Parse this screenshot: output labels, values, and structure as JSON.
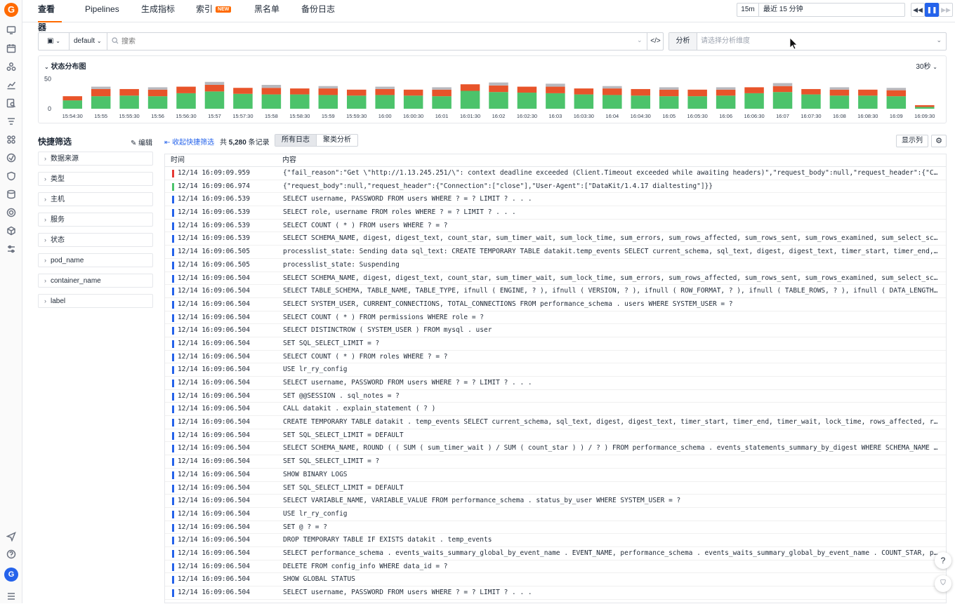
{
  "app": {
    "logo_letter": "G",
    "avatar_letter": "G"
  },
  "nav": {
    "tabs": [
      {
        "label": "查看器",
        "active": true
      },
      {
        "label": "Pipelines"
      },
      {
        "label": "生成指标"
      },
      {
        "label": "索引",
        "badge": "NEW"
      },
      {
        "label": "黑名单"
      },
      {
        "label": "备份日志"
      }
    ]
  },
  "time": {
    "short": "15m",
    "range": "最近 15 分钟",
    "rewind": "◀◀",
    "pause": "❚❚",
    "forward": "▶▶"
  },
  "query": {
    "index": "default",
    "search_placeholder": "搜索",
    "code_label": "</>"
  },
  "analysis": {
    "label": "分析",
    "placeholder": "请选择分析维度"
  },
  "chart": {
    "title": "状态分布图",
    "interval": "30秒",
    "colors": {
      "ok": "#4cc36b",
      "error": "#e8542a",
      "other": "#b8b8bd"
    }
  },
  "chart_data": {
    "type": "bar",
    "title": "状态分布图",
    "stacked": true,
    "ylim": [
      0,
      60
    ],
    "yticks": [
      0,
      50
    ],
    "grid": false,
    "categories": [
      "15:54:30",
      "15:55",
      "15:55:30",
      "15:56",
      "15:56:30",
      "15:57",
      "15:57:30",
      "15:58",
      "15:58:30",
      "15:59",
      "15:59:30",
      "16:00",
      "16:00:30",
      "16:01",
      "16:01:30",
      "16:02",
      "16:02:30",
      "16:03",
      "16:03:30",
      "16:04",
      "16:04:30",
      "16:05",
      "16:05:30",
      "16:06",
      "16:06:30",
      "16:07",
      "16:07:30",
      "16:08",
      "16:08:30",
      "16:09",
      "16:09:30"
    ],
    "series": [
      {
        "key": "ok",
        "values": [
          14,
          21,
          22,
          21,
          26,
          29,
          25,
          24,
          24,
          23,
          22,
          23,
          22,
          21,
          30,
          28,
          27,
          26,
          24,
          23,
          22,
          21,
          21,
          22,
          26,
          28,
          24,
          22,
          22,
          21,
          3
        ]
      },
      {
        "key": "error",
        "values": [
          7,
          12,
          11,
          11,
          11,
          11,
          10,
          11,
          10,
          11,
          10,
          10,
          10,
          11,
          11,
          11,
          10,
          11,
          10,
          11,
          11,
          11,
          11,
          10,
          10,
          10,
          9,
          10,
          10,
          10,
          3
        ]
      },
      {
        "key": "other",
        "values": [
          0,
          4,
          0,
          4,
          0,
          5,
          0,
          5,
          0,
          4,
          0,
          4,
          0,
          4,
          0,
          5,
          0,
          5,
          0,
          4,
          0,
          4,
          0,
          4,
          0,
          5,
          0,
          4,
          0,
          4,
          0
        ]
      }
    ]
  },
  "quick_filter": {
    "title": "快捷筛选",
    "edit": "编辑",
    "items": [
      "数据来源",
      "类型",
      "主机",
      "服务",
      "状态",
      "pod_name",
      "container_name",
      "label"
    ]
  },
  "list": {
    "collapse": "收起快捷筛选",
    "total_prefix": "共",
    "total": "5,280",
    "total_suffix": "条记录",
    "view_tabs": [
      "所有日志",
      "聚类分析"
    ],
    "show_columns": "显示列",
    "col_time": "时间",
    "col_content": "内容"
  },
  "logs": [
    {
      "time": "12/14 16:09:09.959",
      "level": "#e53935",
      "content": "{\"fail_reason\":\"Get \\\"http://1.13.245.251/\\\": context deadline exceeded (Client.Timeout exceeded while awaiting headers)\",\"request_body\":null,\"request_header\":{\"Connection\":[\"close\"],\"User-Agent\":[\"DataKit/1.4.17 dialtesting\"]}}"
    },
    {
      "time": "12/14 16:09:06.974",
      "level": "#4cc36b",
      "content": "{\"request_body\":null,\"request_header\":{\"Connection\":[\"close\"],\"User-Agent\":[\"DataKit/1.4.17 dialtesting\"]}}"
    },
    {
      "time": "12/14 16:09:06.539",
      "level": "#2563eb",
      "content": "SELECT username, PASSWORD FROM users WHERE ? = ? LIMIT ? . . ."
    },
    {
      "time": "12/14 16:09:06.539",
      "level": "#2563eb",
      "content": "SELECT role, username FROM roles WHERE ? = ? LIMIT ? . . ."
    },
    {
      "time": "12/14 16:09:06.539",
      "level": "#2563eb",
      "content": "SELECT COUNT ( * ) FROM users WHERE ? = ?"
    },
    {
      "time": "12/14 16:09:06.539",
      "level": "#2563eb",
      "content": "SELECT SCHEMA_NAME, digest, digest_text, count_star, sum_timer_wait, sum_lock_time, sum_errors, sum_rows_affected, sum_rows_sent, sum_rows_examined, sum_select_scan, sum_select_full_join"
    },
    {
      "time": "12/14 16:09:06.505",
      "level": "#2563eb",
      "content": "processlist_state: Sending data sql_text: CREATE TEMPORARY TABLE datakit.temp_events SELECT current_schema, sql_text, digest, digest_text, timer_start, timer_end, timer_wait, lock_time"
    },
    {
      "time": "12/14 16:09:06.505",
      "level": "#2563eb",
      "content": "processlist_state: Suspending"
    },
    {
      "time": "12/14 16:09:06.504",
      "level": "#2563eb",
      "content": "SELECT SCHEMA_NAME, digest, digest_text, count_star, sum_timer_wait, sum_lock_time, sum_errors, sum_rows_affected, sum_rows_sent, sum_rows_examined, sum_select_scan, sum_select_full_join"
    },
    {
      "time": "12/14 16:09:06.504",
      "level": "#2563eb",
      "content": "SELECT TABLE_SCHEMA, TABLE_NAME, TABLE_TYPE, ifnull ( ENGINE, ? ), ifnull ( VERSION, ? ), ifnull ( ROW_FORMAT, ? ), ifnull ( TABLE_ROWS, ? ), ifnull ( DATA_LENGTH, ? ), ifnull ( INDEX_LENGTH, ? )"
    },
    {
      "time": "12/14 16:09:06.504",
      "level": "#2563eb",
      "content": "SELECT SYSTEM_USER, CURRENT_CONNECTIONS, TOTAL_CONNECTIONS FROM performance_schema . users WHERE SYSTEM_USER = ?"
    },
    {
      "time": "12/14 16:09:06.504",
      "level": "#2563eb",
      "content": "SELECT COUNT ( * ) FROM permissions WHERE role = ?"
    },
    {
      "time": "12/14 16:09:06.504",
      "level": "#2563eb",
      "content": "SELECT DISTINCTROW ( SYSTEM_USER ) FROM mysql . user"
    },
    {
      "time": "12/14 16:09:06.504",
      "level": "#2563eb",
      "content": "SET SQL_SELECT_LIMIT = ?"
    },
    {
      "time": "12/14 16:09:06.504",
      "level": "#2563eb",
      "content": "SELECT COUNT ( * ) FROM roles WHERE ? = ?"
    },
    {
      "time": "12/14 16:09:06.504",
      "level": "#2563eb",
      "content": "USE lr_ry_config"
    },
    {
      "time": "12/14 16:09:06.504",
      "level": "#2563eb",
      "content": "SELECT username, PASSWORD FROM users WHERE ? = ? LIMIT ? . . ."
    },
    {
      "time": "12/14 16:09:06.504",
      "level": "#2563eb",
      "content": "SET @@SESSION . sql_notes = ?"
    },
    {
      "time": "12/14 16:09:06.504",
      "level": "#2563eb",
      "content": "CALL datakit . explain_statement ( ? )"
    },
    {
      "time": "12/14 16:09:06.504",
      "level": "#2563eb",
      "content": "CREATE TEMPORARY TABLE datakit . temp_events SELECT current_schema, sql_text, digest, digest_text, timer_start, timer_end, timer_wait, lock_time, rows_affected, rows_sent, rows_examined"
    },
    {
      "time": "12/14 16:09:06.504",
      "level": "#2563eb",
      "content": "SET SQL_SELECT_LIMIT = DEFAULT"
    },
    {
      "time": "12/14 16:09:06.504",
      "level": "#2563eb",
      "content": "SELECT SCHEMA_NAME, ROUND ( ( SUM ( sum_timer_wait ) / SUM ( count_star ) ) / ? ) FROM performance_schema . events_statements_summary_by_digest WHERE SCHEMA_NAME IS NOT ? GROUP BY SCHEMA_NAME"
    },
    {
      "time": "12/14 16:09:06.504",
      "level": "#2563eb",
      "content": "SET SQL_SELECT_LIMIT = ?"
    },
    {
      "time": "12/14 16:09:06.504",
      "level": "#2563eb",
      "content": "SHOW BINARY LOGS"
    },
    {
      "time": "12/14 16:09:06.504",
      "level": "#2563eb",
      "content": "SET SQL_SELECT_LIMIT = DEFAULT"
    },
    {
      "time": "12/14 16:09:06.504",
      "level": "#2563eb",
      "content": "SELECT VARIABLE_NAME, VARIABLE_VALUE FROM performance_schema . status_by_user WHERE SYSTEM_USER = ?"
    },
    {
      "time": "12/14 16:09:06.504",
      "level": "#2563eb",
      "content": "USE lr_ry_config"
    },
    {
      "time": "12/14 16:09:06.504",
      "level": "#2563eb",
      "content": "SET @ ? = ?"
    },
    {
      "time": "12/14 16:09:06.504",
      "level": "#2563eb",
      "content": "DROP TEMPORARY TABLE IF EXISTS datakit . temp_events"
    },
    {
      "time": "12/14 16:09:06.504",
      "level": "#2563eb",
      "content": "SELECT performance_schema . events_waits_summary_global_by_event_name . EVENT_NAME, performance_schema . events_waits_summary_global_by_event_name . COUNT_STAR, performance_schema . events_waits_summary_global_by_event_name . SUM_TIMER_WAIT"
    },
    {
      "time": "12/14 16:09:06.504",
      "level": "#2563eb",
      "content": "DELETE FROM config_info WHERE data_id = ?"
    },
    {
      "time": "12/14 16:09:06.504",
      "level": "#2563eb",
      "content": "SHOW GLOBAL STATUS"
    },
    {
      "time": "12/14 16:09:06.504",
      "level": "#2563eb",
      "content": "SELECT username, PASSWORD FROM users WHERE ? = ? LIMIT ? . . ."
    }
  ],
  "fab": {
    "help": "?",
    "filter": "⛉"
  }
}
